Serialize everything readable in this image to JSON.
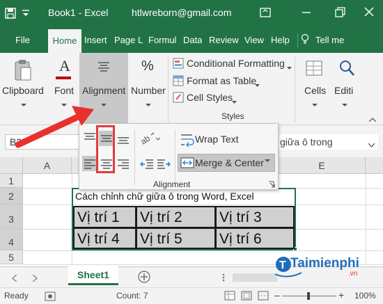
{
  "title_bar": {
    "doc_title": "Book1  -  Excel",
    "account": "htlwreborn@gmail.com"
  },
  "tabs": [
    {
      "label": "File"
    },
    {
      "label": "Home"
    },
    {
      "label": "Insert"
    },
    {
      "label": "Page L"
    },
    {
      "label": "Formul"
    },
    {
      "label": "Data"
    },
    {
      "label": "Review"
    },
    {
      "label": "View"
    },
    {
      "label": "Help"
    },
    {
      "label": "Tell me"
    }
  ],
  "ribbon": {
    "clipboard": "Clipboard",
    "font": "Font",
    "alignment": "Alignment",
    "number": "Number",
    "conditional_formatting": "Conditional Formatting",
    "format_as_table": "Format as Table",
    "cell_styles": "Cell Styles",
    "styles": "Styles",
    "cells": "Cells",
    "editing": "Editi",
    "font_letter": "A",
    "number_symbol": "%"
  },
  "alignment_panel": {
    "wrap_text": "Wrap Text",
    "merge_center": "Merge & Center",
    "group_label": "Alignment"
  },
  "formula_bar": {
    "name_box": "B2",
    "value": "giữa ô trong"
  },
  "columns": [
    "A",
    "E"
  ],
  "rows": [
    "1",
    "2",
    "3",
    "4",
    "5"
  ],
  "cells": {
    "b2": "Cách chỉnh chữ giữa ô trong Word, Excel",
    "b3": "Vị trí 1",
    "c3": "Vị trí 2",
    "d3": "Vị trí 3",
    "b4": "Vị trí 4",
    "c4": "Vị trí 5",
    "d4": "Vị trí 6"
  },
  "sheet_tabs": [
    {
      "label": "Sheet1"
    }
  ],
  "status": {
    "ready": "Ready",
    "count": "Count: 7",
    "zoom": "100%"
  },
  "watermark": {
    "brand": "Taimienphi",
    "suffix": ".vn"
  },
  "colors": {
    "excel_green": "#217346",
    "arrow_red": "#e8312f",
    "highlight_red": "#e03c3c",
    "selection_green": "#217346"
  }
}
